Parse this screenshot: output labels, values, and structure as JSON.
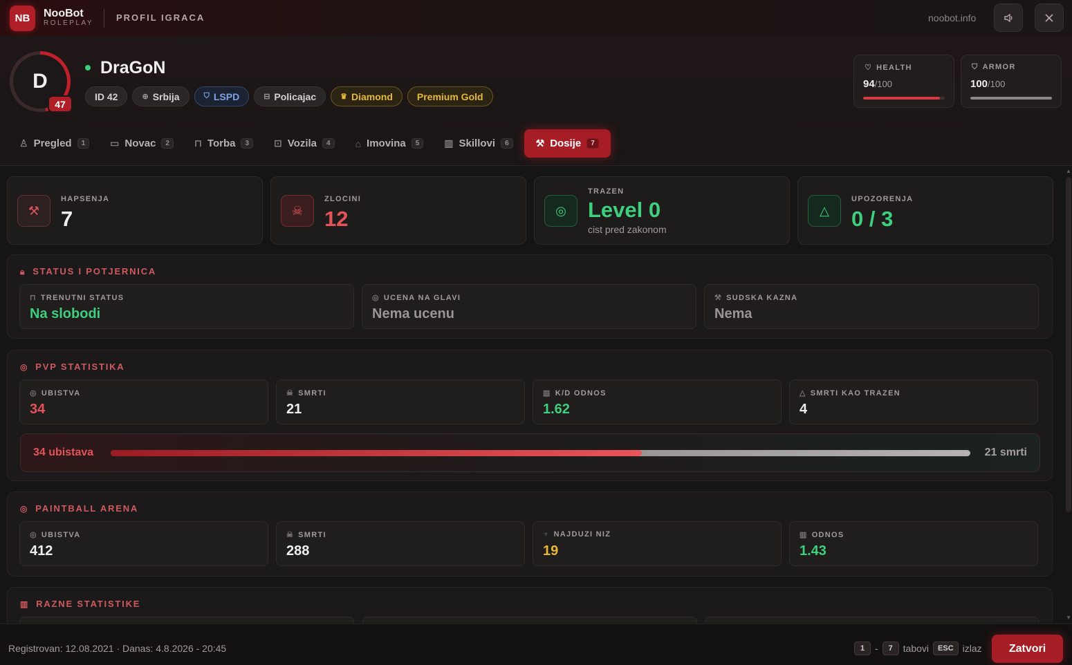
{
  "app": {
    "logo": "NB",
    "name": "NooBot",
    "subtitle": "ROLEPLAY",
    "page_title": "PROFIL IGRACA",
    "site": "noobot.info"
  },
  "window_buttons": [
    {
      "name": "sound-icon"
    },
    {
      "name": "close-icon"
    }
  ],
  "player": {
    "initial": "D",
    "level": "47",
    "level_progress": 0.47,
    "name": "DraGoN",
    "online": true,
    "chips": [
      {
        "label": "ID 42",
        "icon": "",
        "style": "plain"
      },
      {
        "label": "Srbija",
        "icon": "globe-icon",
        "style": "plain"
      },
      {
        "label": "LSPD",
        "icon": "shield-icon",
        "style": "blue"
      },
      {
        "label": "Policajac",
        "icon": "briefcase-icon",
        "style": "plain"
      },
      {
        "label": "Diamond",
        "icon": "crown-icon",
        "style": "gold"
      },
      {
        "label": "Premium Gold",
        "icon": "",
        "style": "gold"
      }
    ]
  },
  "vitals": {
    "health": {
      "label": "HEALTH",
      "value": "94",
      "max": "/100",
      "fraction": 0.94,
      "color": "#d33a42"
    },
    "armor": {
      "label": "ARMOR",
      "value": "100",
      "max": "/100",
      "fraction": 1.0,
      "color": "#8a8586"
    }
  },
  "tabs": [
    {
      "label": "Pregled",
      "key": "1",
      "icon": "user-icon"
    },
    {
      "label": "Novac",
      "key": "2",
      "icon": "money-icon"
    },
    {
      "label": "Torba",
      "key": "3",
      "icon": "bag-icon"
    },
    {
      "label": "Vozila",
      "key": "4",
      "icon": "car-icon"
    },
    {
      "label": "Imovina",
      "key": "5",
      "icon": "house-icon"
    },
    {
      "label": "Skillovi",
      "key": "6",
      "icon": "chart-icon"
    },
    {
      "label": "Dosije",
      "key": "7",
      "icon": "gavel-icon",
      "active": true
    }
  ],
  "summary": [
    {
      "label": "HAPSENJA",
      "value": "7",
      "sub": "",
      "icon": "gavel-icon",
      "color": "#f1eeee"
    },
    {
      "label": "ZLOCINI",
      "value": "12",
      "sub": "",
      "icon": "skull-icon",
      "color": "#e4535a"
    },
    {
      "label": "TRAZEN",
      "value": "Level 0",
      "sub": "cist pred zakonom",
      "icon": "target-icon",
      "color": "#3ecf7f"
    },
    {
      "label": "UPOZORENJA",
      "value": "0 / 3",
      "sub": "",
      "icon": "warning-icon",
      "color": "#3ecf7f"
    }
  ],
  "status": {
    "title": "STATUS I POTJERNICA",
    "items": [
      {
        "label": "TRENUTNI STATUS",
        "value": "Na slobodi",
        "icon": "lock-icon",
        "color": "#3ecf7f"
      },
      {
        "label": "UCENA NA GLAVI",
        "value": "Nema ucenu",
        "icon": "target-icon",
        "color": "#9b9394"
      },
      {
        "label": "SUDSKA KAZNA",
        "value": "Nema",
        "icon": "gavel-icon",
        "color": "#9b9394"
      }
    ]
  },
  "pvp": {
    "title": "PVP STATISTIKA",
    "items": [
      {
        "label": "UBISTVA",
        "value": "34",
        "icon": "target-icon",
        "color": "#e4535a"
      },
      {
        "label": "SMRTI",
        "value": "21",
        "icon": "skull-icon",
        "color": "#f1eeee"
      },
      {
        "label": "K/D ODNOS",
        "value": "1.62",
        "icon": "chart-icon",
        "color": "#3ecf7f"
      },
      {
        "label": "SMRTI KAO TRAZEN",
        "value": "4",
        "icon": "warning-icon",
        "color": "#f1eeee"
      }
    ],
    "bar": {
      "left": "34 ubistava",
      "right": "21 smrti",
      "kills": 34,
      "deaths": 21
    }
  },
  "paintball": {
    "title": "PAINTBALL ARENA",
    "items": [
      {
        "label": "UBISTVA",
        "value": "412",
        "icon": "target-icon",
        "color": "#f1eeee"
      },
      {
        "label": "SMRTI",
        "value": "288",
        "icon": "skull-icon",
        "color": "#f1eeee"
      },
      {
        "label": "NAJDUZI NIZ",
        "value": "19",
        "icon": "trophy-icon",
        "color": "#e8b83a"
      },
      {
        "label": "ODNOS",
        "value": "1.43",
        "icon": "chart-icon",
        "color": "#3ecf7f"
      }
    ]
  },
  "misc": {
    "title": "RAZNE STATISTIKE"
  },
  "footer": {
    "registered": "Registrovan: 12.08.2021 · Danas: 4.8.2026 - 20:45",
    "key1": "1",
    "dash": "-",
    "key2": "7",
    "tabs_text": "tabovi",
    "esc": "ESC",
    "exit_text": "izlaz",
    "close_label": "Zatvori"
  }
}
